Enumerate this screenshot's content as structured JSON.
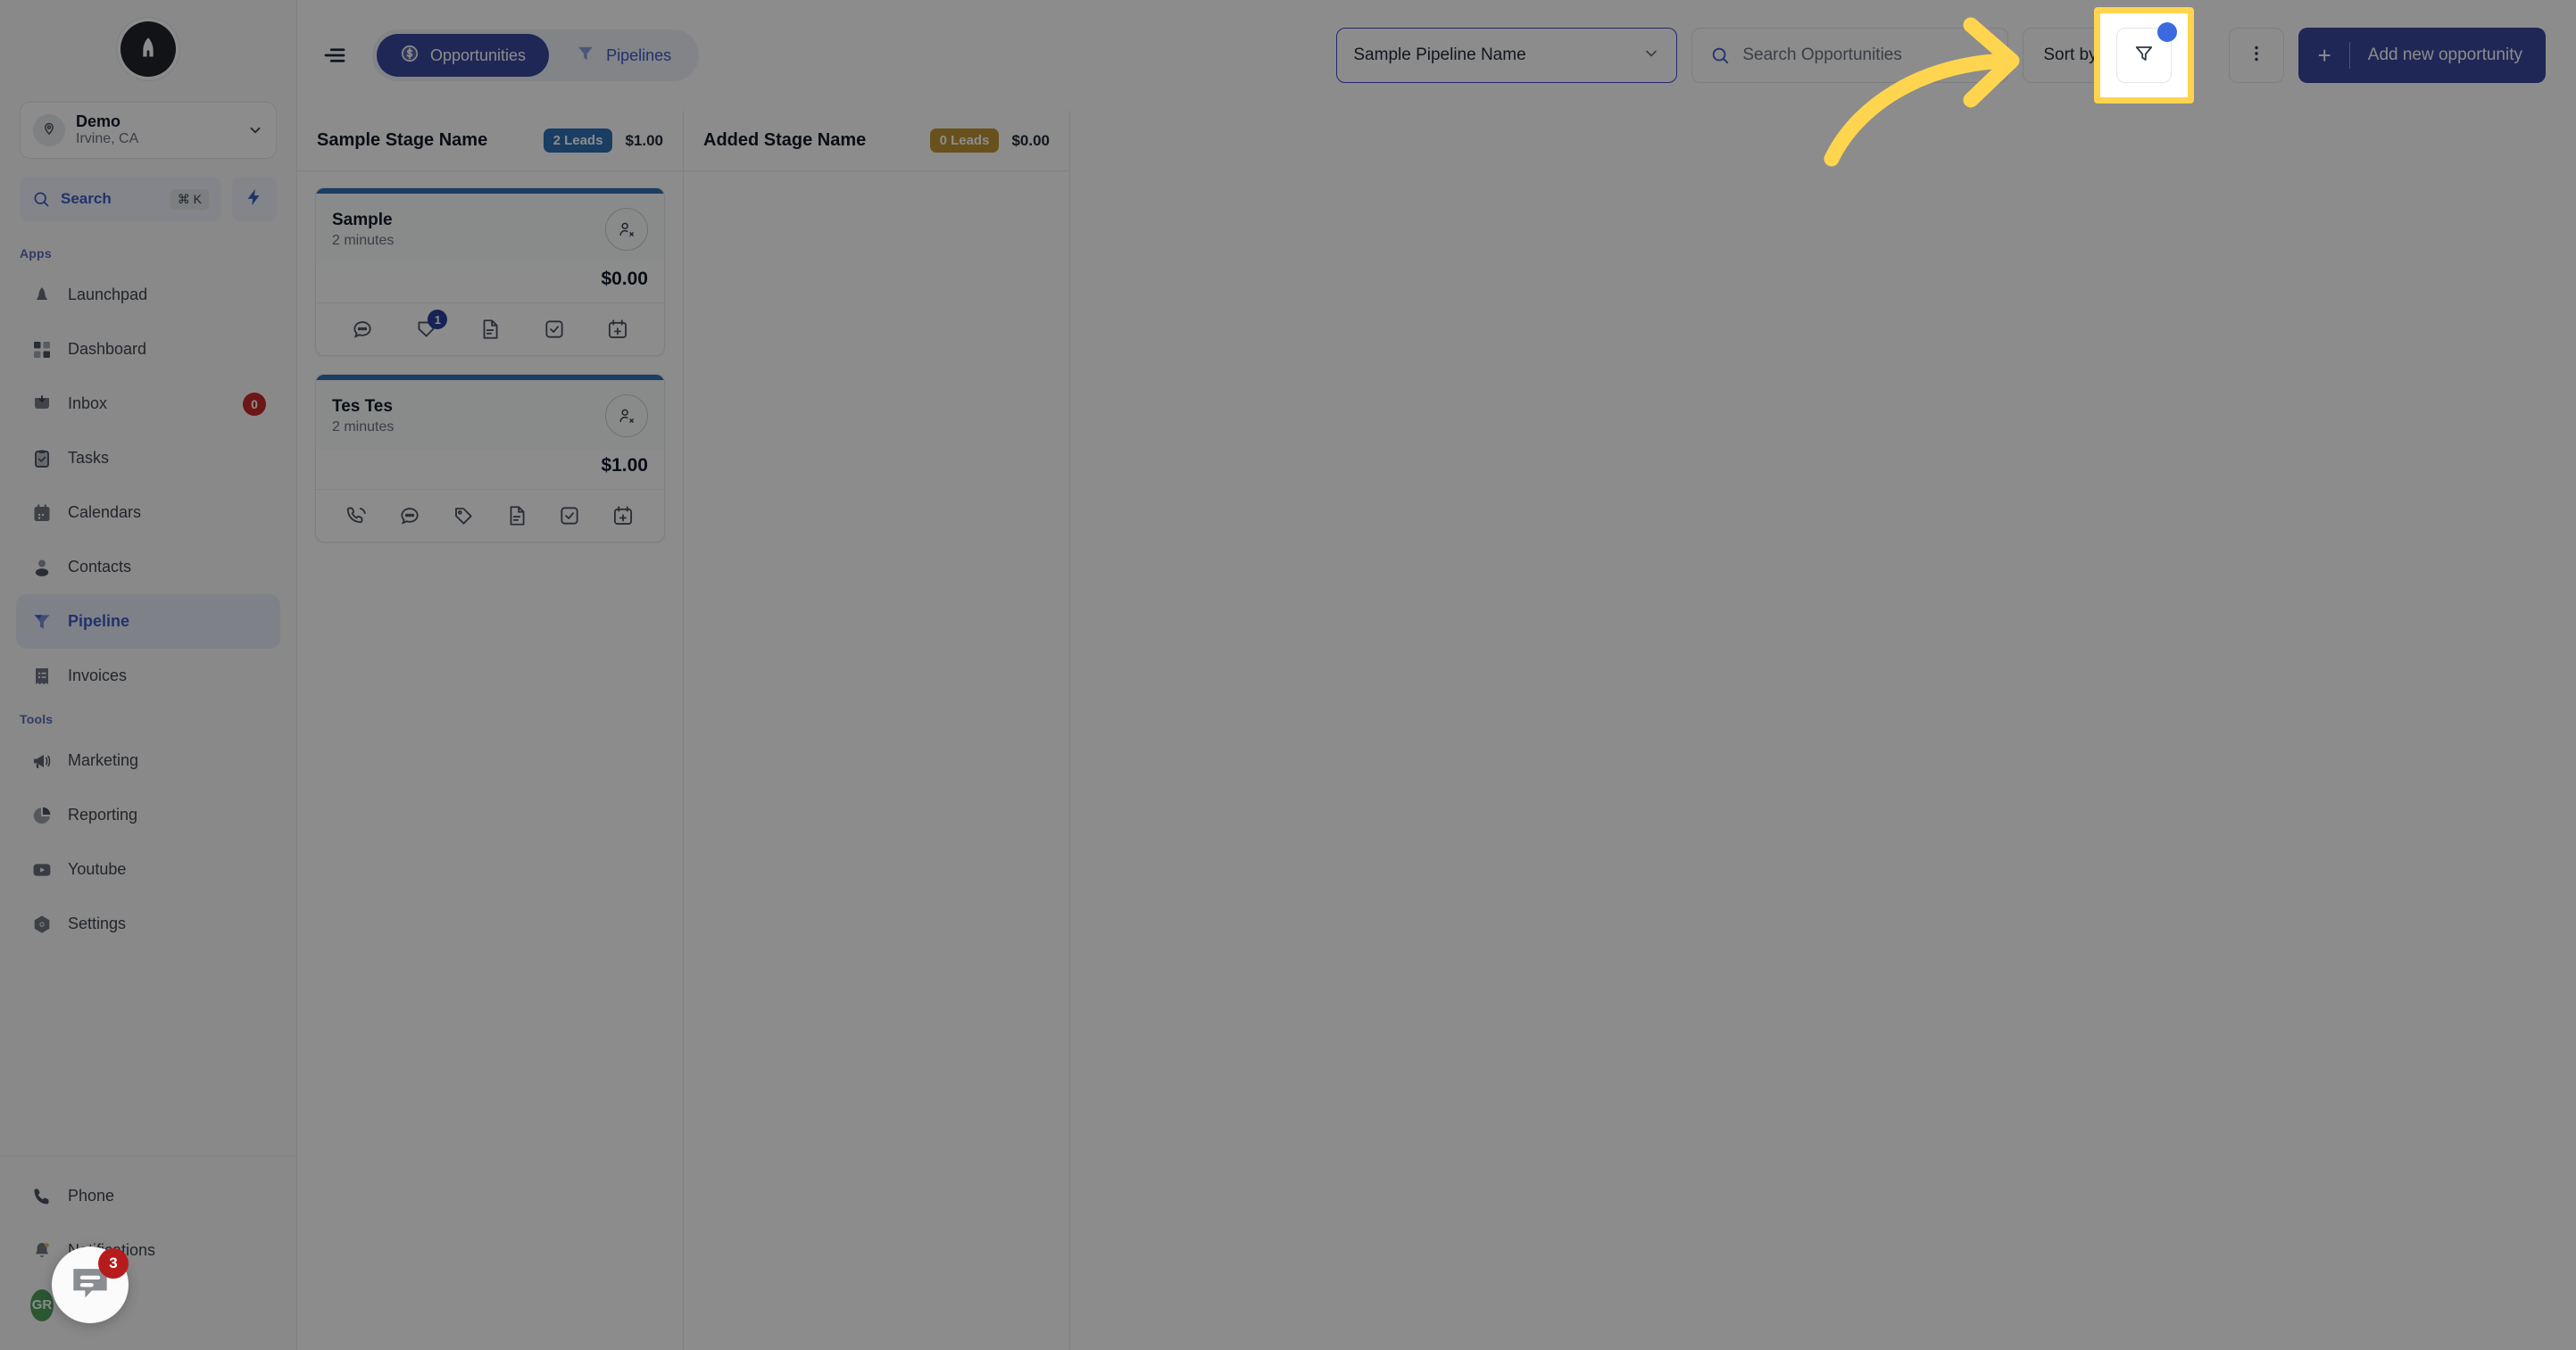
{
  "sidebar": {
    "brand": {
      "icon": "rocket-logo-icon"
    },
    "location": {
      "name": "Demo",
      "sublabel": "Irvine, CA",
      "chevron": "chevron-down-icon",
      "avatar_icon": "map-pin-icon"
    },
    "search": {
      "label": "Search",
      "shortcut": "⌘ K",
      "icon": "search-icon",
      "bolt_icon": "lightning-bolt-icon"
    },
    "groups": [
      {
        "label": "Apps",
        "items": [
          {
            "label": "Launchpad",
            "icon": "launchpad-icon",
            "badge": "",
            "active": false
          },
          {
            "label": "Dashboard",
            "icon": "dashboard-grid-icon",
            "badge": "",
            "active": false
          },
          {
            "label": "Inbox",
            "icon": "inbox-icon",
            "badge": "0",
            "active": false
          },
          {
            "label": "Tasks",
            "icon": "tasks-clipboard-icon",
            "badge": "",
            "active": false
          },
          {
            "label": "Calendars",
            "icon": "calendar-icon",
            "badge": "",
            "active": false
          },
          {
            "label": "Contacts",
            "icon": "contacts-person-icon",
            "badge": "",
            "active": false
          },
          {
            "label": "Pipeline",
            "icon": "pipeline-funnel-icon",
            "badge": "",
            "active": true
          },
          {
            "label": "Invoices",
            "icon": "invoice-receipt-icon",
            "badge": "",
            "active": false
          }
        ]
      },
      {
        "label": "Tools",
        "items": [
          {
            "label": "Marketing",
            "icon": "megaphone-icon",
            "badge": "",
            "active": false
          },
          {
            "label": "Reporting",
            "icon": "pie-chart-icon",
            "badge": "",
            "active": false
          },
          {
            "label": "Youtube",
            "icon": "youtube-icon",
            "badge": "",
            "active": false
          },
          {
            "label": "Settings",
            "icon": "settings-gear-icon",
            "badge": "",
            "active": false
          }
        ]
      }
    ],
    "bottom_items": [
      {
        "label": "Phone",
        "icon": "phone-icon",
        "badge": ""
      },
      {
        "label": "Notifications",
        "icon": "bell-icon",
        "badge": ""
      },
      {
        "label": "Profile",
        "icon": "avatar-icon",
        "avatar_initials": "GR"
      }
    ]
  },
  "topbar": {
    "collapse_icon": "collapse-sidebar-icon",
    "tabs": [
      {
        "label": "Opportunities",
        "icon": "dollar-circle-icon",
        "active": true
      },
      {
        "label": "Pipelines",
        "icon": "pipeline-funnel-icon",
        "active": false
      }
    ],
    "pipeline_select": {
      "value": "Sample Pipeline Name",
      "chevron": "chevron-down-icon"
    },
    "search": {
      "placeholder": "Search Opportunities",
      "value": "",
      "icon": "search-icon"
    },
    "sort_button": {
      "label": "Sort by",
      "icon": "chevron-down-icon"
    },
    "filter_button": {
      "icon": "filter-funnel-icon",
      "has_dot": true
    },
    "more_button": {
      "icon": "more-vertical-icon"
    },
    "add_button": {
      "label": "Add new opportunity",
      "plus": "+"
    }
  },
  "board": {
    "stages": [
      {
        "name": "Sample Stage Name",
        "lead_count": "2 Leads",
        "badge_color": "#2f6fb5",
        "total": "$1.00",
        "cards": [
          {
            "title": "Sample",
            "time": "2 minutes",
            "amount": "$0.00",
            "assign_icon": "person-remove-icon",
            "actions": [
              {
                "icon": "chat-bubble-icon",
                "count": ""
              },
              {
                "icon": "tag-shield-icon",
                "count": "1"
              },
              {
                "icon": "document-icon",
                "count": ""
              },
              {
                "icon": "task-check-icon",
                "count": ""
              },
              {
                "icon": "calendar-add-icon",
                "count": ""
              }
            ]
          },
          {
            "title": "Tes Tes",
            "time": "2 minutes",
            "amount": "$1.00",
            "assign_icon": "person-remove-icon",
            "actions": [
              {
                "icon": "phone-call-icon",
                "count": ""
              },
              {
                "icon": "chat-bubble-icon",
                "count": ""
              },
              {
                "icon": "tag-icon",
                "count": ""
              },
              {
                "icon": "document-icon",
                "count": ""
              },
              {
                "icon": "task-check-icon",
                "count": ""
              },
              {
                "icon": "calendar-add-icon",
                "count": ""
              }
            ]
          }
        ]
      },
      {
        "name": "Added Stage Name",
        "lead_count": "0 Leads",
        "badge_color": "#bf9433",
        "total": "$0.00",
        "cards": []
      }
    ]
  },
  "chat_widget": {
    "icon": "chat-message-icon",
    "badge": "3"
  },
  "annotation": {
    "highlight_target": "filter-button",
    "arrow_color": "#ffd54f",
    "box_color": "#ffd54f"
  },
  "colors": {
    "accent_blue": "#37479b",
    "link_blue": "#3c5cc4",
    "badge_blue": "#2f6fb5",
    "badge_amber": "#bf9433",
    "badge_red": "#c62828",
    "highlight_yellow": "#ffd54f"
  }
}
